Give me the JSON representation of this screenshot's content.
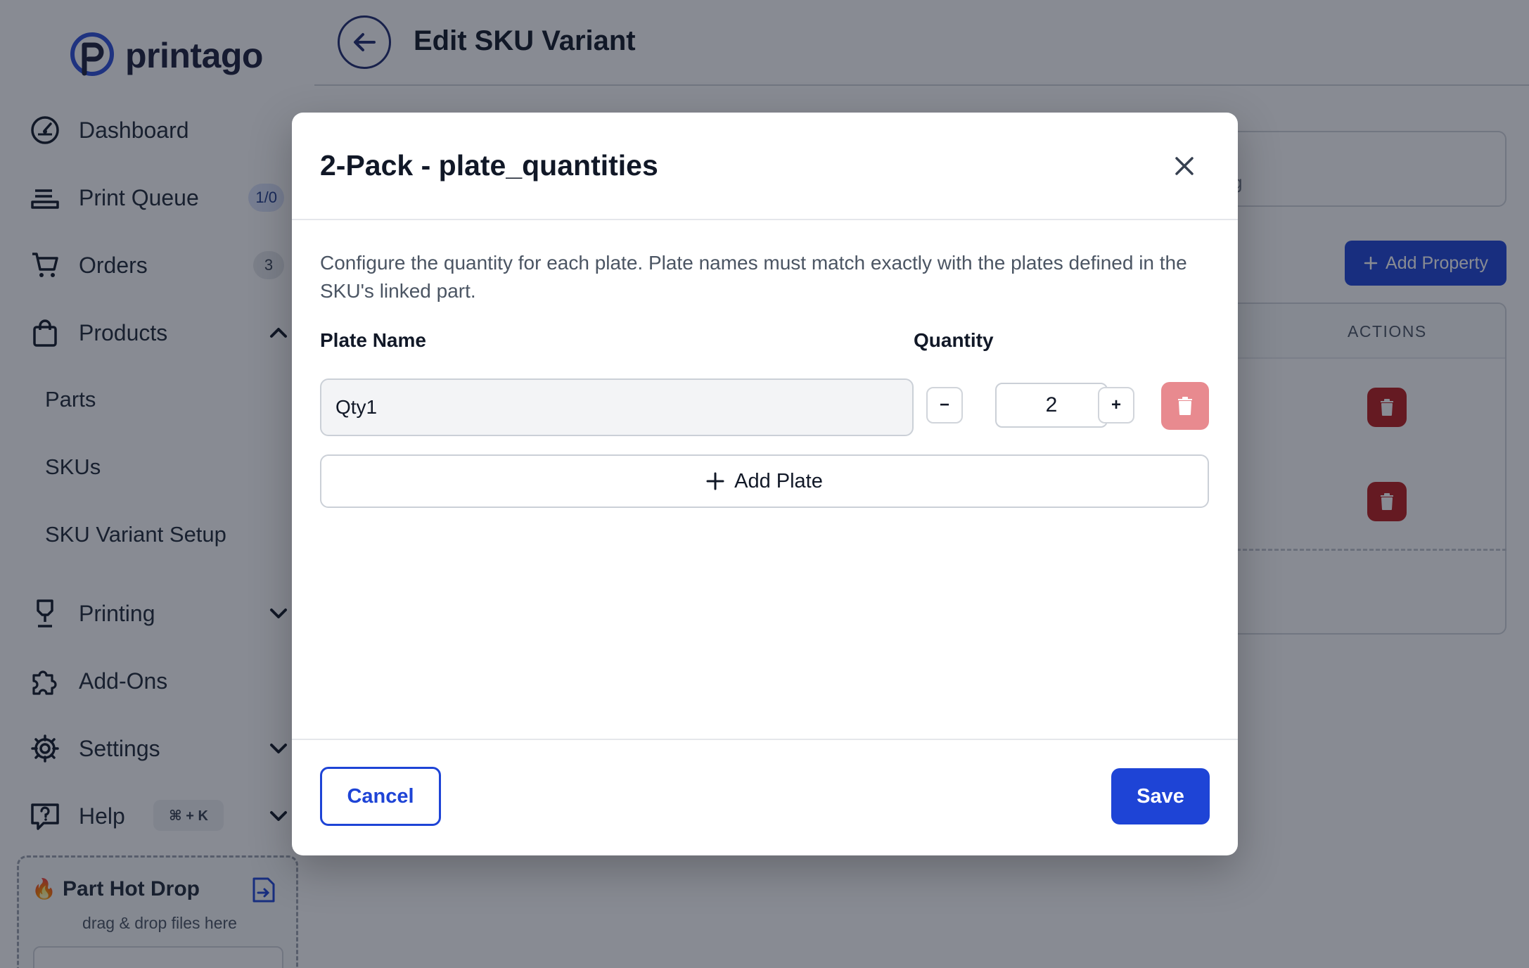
{
  "app": {
    "logo_text": "printago",
    "brand_color": "#1e44d6"
  },
  "sidebar": {
    "items": [
      {
        "label": "Dashboard",
        "icon": "gauge-icon"
      },
      {
        "label": "Print Queue",
        "icon": "queue-icon",
        "badge": "1/0"
      },
      {
        "label": "Orders",
        "icon": "cart-icon",
        "badge": "3"
      },
      {
        "label": "Products",
        "icon": "bag-icon",
        "expanded": true
      },
      {
        "label": "Printing",
        "icon": "printer-icon"
      },
      {
        "label": "Add-Ons",
        "icon": "puzzle-icon"
      },
      {
        "label": "Settings",
        "icon": "gear-icon"
      },
      {
        "label": "Help",
        "icon": "help-icon",
        "shortcut": "⌘ + K"
      }
    ],
    "products_sub": [
      "Parts",
      "SKUs",
      "SKU Variant Setup"
    ],
    "hot_drop": {
      "title": "Part Hot Drop",
      "subtitle": "drag & drop files here"
    }
  },
  "header": {
    "title": "Edit SKU Variant"
  },
  "background": {
    "add_property_label": "Add Property",
    "actions_header": "ACTIONS",
    "card_partial_text": "g"
  },
  "modal": {
    "title": "2-Pack - plate_quantities",
    "description": "Configure the quantity for each plate. Plate names must match exactly with the plates defined in the SKU's linked part.",
    "col_plate_name": "Plate Name",
    "col_quantity": "Quantity",
    "plates": [
      {
        "name": "Qty1",
        "quantity": "2"
      }
    ],
    "decrement_label": "−",
    "increment_label": "+",
    "add_plate_label": "Add Plate",
    "cancel_label": "Cancel",
    "save_label": "Save"
  }
}
